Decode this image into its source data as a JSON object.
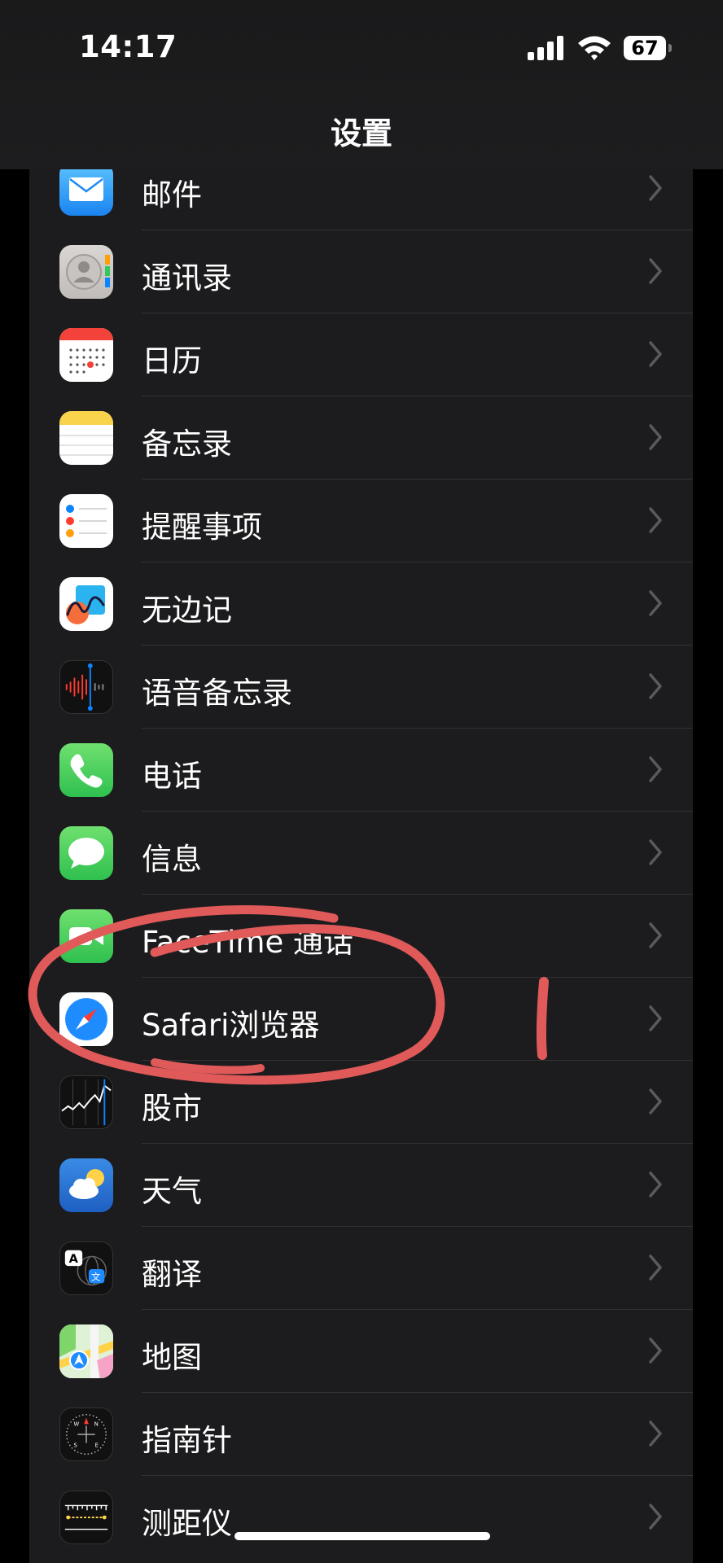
{
  "status_bar": {
    "time": "14:17",
    "battery": "67"
  },
  "nav": {
    "title": "设置"
  },
  "items": [
    {
      "label": "邮件",
      "icon": "mail-icon"
    },
    {
      "label": "通讯录",
      "icon": "contacts-icon"
    },
    {
      "label": "日历",
      "icon": "calendar-icon"
    },
    {
      "label": "备忘录",
      "icon": "notes-icon"
    },
    {
      "label": "提醒事项",
      "icon": "reminders-icon"
    },
    {
      "label": "无边记",
      "icon": "freeform-icon"
    },
    {
      "label": "语音备忘录",
      "icon": "voice-memos-icon"
    },
    {
      "label": "电话",
      "icon": "phone-icon"
    },
    {
      "label": "信息",
      "icon": "messages-icon"
    },
    {
      "label": "FaceTime 通话",
      "icon": "facetime-icon"
    },
    {
      "label": "Safari浏览器",
      "icon": "safari-icon"
    },
    {
      "label": "股市",
      "icon": "stocks-icon"
    },
    {
      "label": "天气",
      "icon": "weather-icon"
    },
    {
      "label": "翻译",
      "icon": "translate-icon"
    },
    {
      "label": "地图",
      "icon": "maps-icon"
    },
    {
      "label": "指南针",
      "icon": "compass-icon"
    },
    {
      "label": "测距仪",
      "icon": "measure-icon"
    }
  ],
  "annotation": {
    "color": "#e05a5a"
  }
}
